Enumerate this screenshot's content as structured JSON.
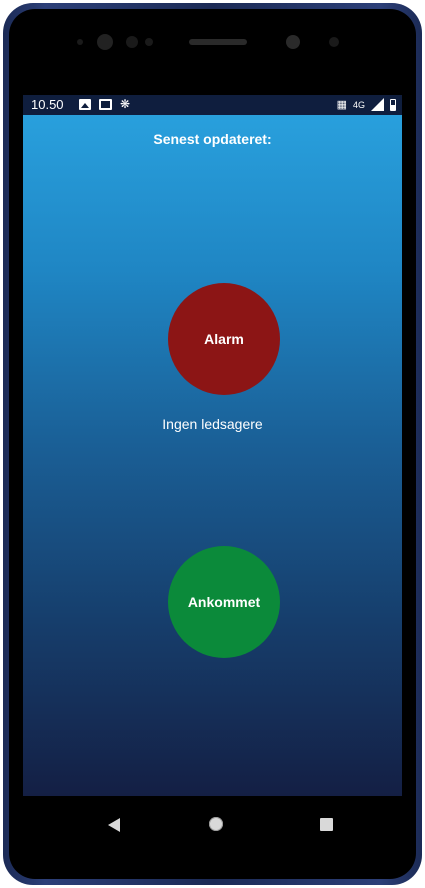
{
  "status_bar": {
    "time": "10.50",
    "network": "4G",
    "icons": [
      "image-icon",
      "news-icon",
      "bird-icon",
      "vibrate-icon",
      "signal-icon",
      "battery-icon"
    ]
  },
  "header": {
    "title": "Senest opdateret:"
  },
  "alarm_button": {
    "label": "Alarm",
    "color": "#8c1515"
  },
  "companions": {
    "label": "Ingen ledsagere"
  },
  "arrived_button": {
    "label": "Ankommet",
    "color": "#0b8a3a"
  },
  "nav_bar": {
    "icons": [
      "back-icon",
      "home-icon",
      "recents-icon"
    ]
  }
}
